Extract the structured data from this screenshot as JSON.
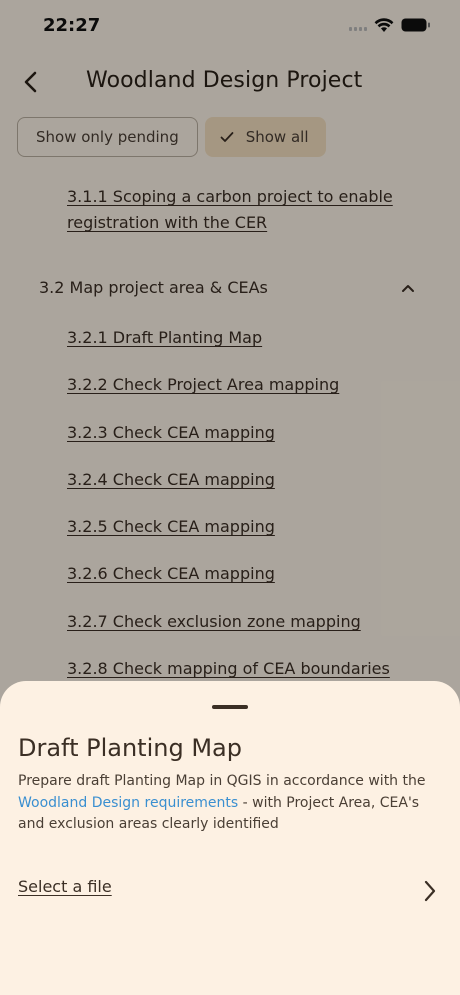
{
  "status": {
    "time": "22:27"
  },
  "header": {
    "title": "Woodland Design Project"
  },
  "filters": [
    {
      "label": "Show only pending",
      "selected": false
    },
    {
      "label": "Show all",
      "selected": true
    }
  ],
  "list": {
    "top_item": "3.1.1 Scoping a carbon project to enable registration with the CER",
    "section": {
      "label": "3.2 Map project area & CEAs",
      "expanded": true
    },
    "items": [
      "3.2.1 Draft Planting Map",
      "3.2.2 Check Project Area mapping",
      "3.2.3 Check CEA mapping",
      "3.2.4 Check CEA mapping",
      "3.2.5 Check CEA mapping",
      "3.2.6 Check CEA mapping",
      "3.2.7 Check exclusion zone mapping",
      "3.2.8 Check mapping of CEA boundaries"
    ]
  },
  "sheet": {
    "title": "Draft Planting Map",
    "desc_before": "Prepare draft Planting Map in QGIS in accordance with the ",
    "desc_link": "Woodland Design requirements",
    "desc_after": " - with Project Area, CEA's and exclusion areas clearly identified",
    "file_label": "Select a file"
  },
  "colors": {
    "background": "#fdf4e7",
    "chip_selected": "#f3dfc0",
    "link": "#3a8fd0",
    "text": "#3b2f25"
  }
}
